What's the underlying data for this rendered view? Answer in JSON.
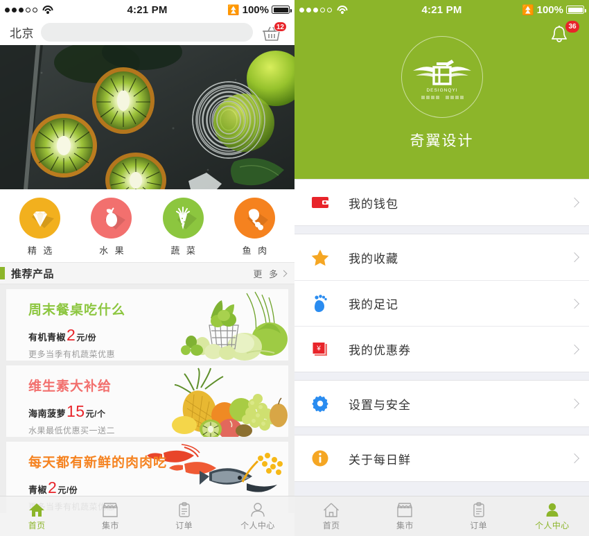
{
  "status_bar": {
    "signal_dots": [
      true,
      true,
      true,
      false,
      false
    ],
    "wifi_icon": "wifi-icon",
    "time": "4:21 PM",
    "bluetooth_icon": "bluetooth-icon",
    "battery_percent": "100%",
    "battery_icon": "battery-full-icon"
  },
  "left_screen": {
    "header": {
      "city": "北京",
      "search_placeholder": "",
      "search_value": "",
      "search_icon": "search-icon",
      "cart_icon": "shopping-basket-icon",
      "cart_badge": "12"
    },
    "hero": {
      "alt": "kiwi-fruit-banner"
    },
    "categories": [
      {
        "label": "精 选",
        "icon": "diamond-icon",
        "color": "#f2b01e"
      },
      {
        "label": "水 果",
        "icon": "pear-icon",
        "color": "#f2706e"
      },
      {
        "label": "蔬 菜",
        "icon": "carrot-icon",
        "color": "#8cc63f"
      },
      {
        "label": "鱼 肉",
        "icon": "chicken-leg-icon",
        "color": "#f5821f"
      }
    ],
    "section": {
      "title": "推荐产品",
      "more": "更 多",
      "more_icon": "chevron-right-icon",
      "accent": "#8cb52a"
    },
    "cards": [
      {
        "title": "周末餐桌吃什么",
        "title_color": "#8cc63f",
        "price_prefix": "有机青椒",
        "price_value": "2",
        "price_unit": "元/份",
        "subtitle": "更多当季有机蔬菜优惠",
        "image": "green-vegetables-basket"
      },
      {
        "title": "维生素大补给",
        "title_color": "#f2706e",
        "price_prefix": "海南菠萝",
        "price_value": "15",
        "price_unit": "元/个",
        "subtitle": "水果最低优惠买一送二",
        "image": "assorted-fruits-pineapple"
      },
      {
        "title": "每天都有新鲜的肉肉吃",
        "title_color": "#f5821f",
        "price_prefix": "青椒",
        "price_value": "2",
        "price_unit": "元/份",
        "subtitle": "更多当季有机蔬菜优惠",
        "image": "shrimp-and-fish"
      }
    ],
    "tabs": [
      {
        "label": "首页",
        "icon": "home-icon",
        "active": true
      },
      {
        "label": "集市",
        "icon": "market-stall-icon",
        "active": false
      },
      {
        "label": "订单",
        "icon": "clipboard-icon",
        "active": false
      },
      {
        "label": "个人中心",
        "icon": "person-icon",
        "active": false
      }
    ]
  },
  "right_screen": {
    "header": {
      "background": "#8cb52a",
      "bell_icon": "bell-icon",
      "bell_badge": "36",
      "logo_icon": "qiyi-wings-logo",
      "logo_sub": "DESIGNQYI",
      "brand_name": "奇翼设计"
    },
    "menu_groups": [
      [
        {
          "label": "我的钱包",
          "icon": "wallet-icon",
          "color": "#e8242a",
          "chevron": "chevron-right-icon"
        }
      ],
      [
        {
          "label": "我的收藏",
          "icon": "star-icon",
          "color": "#f5a623",
          "chevron": "chevron-right-icon"
        },
        {
          "label": "我的足记",
          "icon": "footprint-icon",
          "color": "#2a8cf0",
          "chevron": "chevron-right-icon"
        },
        {
          "label": "我的优惠券",
          "icon": "coupon-icon",
          "color": "#e8242a",
          "chevron": "chevron-right-icon"
        }
      ],
      [
        {
          "label": "设置与安全",
          "icon": "gear-icon",
          "color": "#2a8cf0",
          "chevron": "chevron-right-icon"
        }
      ],
      [
        {
          "label": "关于每日鲜",
          "icon": "info-icon",
          "color": "#f5a623",
          "chevron": "chevron-right-icon"
        }
      ]
    ],
    "tabs": [
      {
        "label": "首页",
        "icon": "home-icon",
        "active": false
      },
      {
        "label": "集市",
        "icon": "market-stall-icon",
        "active": false
      },
      {
        "label": "订单",
        "icon": "clipboard-icon",
        "active": false
      },
      {
        "label": "个人中心",
        "icon": "person-icon",
        "active": true
      }
    ]
  }
}
